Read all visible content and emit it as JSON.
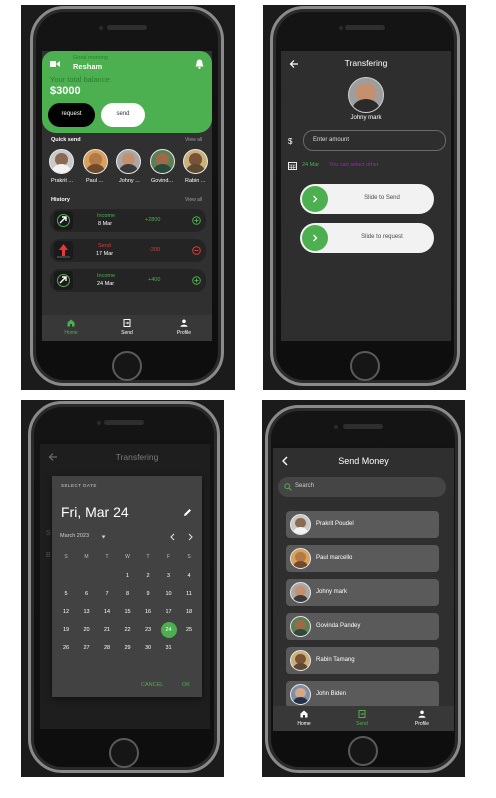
{
  "home": {
    "greeting": "Good morning",
    "user_name": "Resham",
    "balance_label": "Your total balance",
    "balance": "$3000",
    "request_label": "request",
    "send_label": "send",
    "quick_send_label": "Quick send",
    "view_all_label": "View all",
    "contacts": [
      "Prakrit ...",
      "Paul ...",
      "Johny ...",
      "Govind...",
      "Rabin ..."
    ],
    "history_label": "History",
    "history": [
      {
        "type": "Income",
        "date": "8 Mar",
        "amount": "+2800"
      },
      {
        "type": "Send",
        "date": "17 Mar",
        "amount": "-200"
      },
      {
        "type": "Income",
        "date": "24 Mar",
        "amount": "+400"
      }
    ],
    "nav": [
      "Home",
      "Send",
      "Profile"
    ]
  },
  "transfer": {
    "title": "Transfering",
    "contact_name": "Johny mark",
    "currency_symbol": "$",
    "amount_placeholder": "Enter amount",
    "date": "24 Mar",
    "note": "You can select other",
    "slide_send": "Slide to Send",
    "slide_request": "Slide to request"
  },
  "datepicker": {
    "title": "Transfering",
    "header_label": "SELECT DATE",
    "selected_date": "Fri, Mar 24",
    "month_label": "March 2023",
    "weekdays": [
      "S",
      "M",
      "T",
      "W",
      "T",
      "F",
      "S"
    ],
    "days": [
      "1",
      "2",
      "3",
      "4",
      "5",
      "6",
      "7",
      "8",
      "9",
      "10",
      "11",
      "12",
      "13",
      "14",
      "15",
      "16",
      "17",
      "18",
      "19",
      "20",
      "21",
      "22",
      "23",
      "24",
      "25",
      "26",
      "27",
      "28",
      "29",
      "30",
      "31"
    ],
    "selected_day": "24",
    "cancel_label": "CANCEL",
    "ok_label": "OK",
    "behind_letters": [
      "S",
      "B"
    ]
  },
  "send_money": {
    "title": "Send Money",
    "search_placeholder": "Search",
    "contacts": [
      "Prakrit Poudel",
      "Paul marcello",
      "Johny mark",
      "Govinda Pandey",
      "Rabin Tamang",
      "John Biden"
    ],
    "nav": [
      "Home",
      "Send",
      "Profile"
    ]
  },
  "colors": {
    "accent_green": "#4caf50",
    "income_green": "#4caf50",
    "send_red": "#e53935",
    "screen_bg": "#303030",
    "card_bg": "#242424"
  }
}
